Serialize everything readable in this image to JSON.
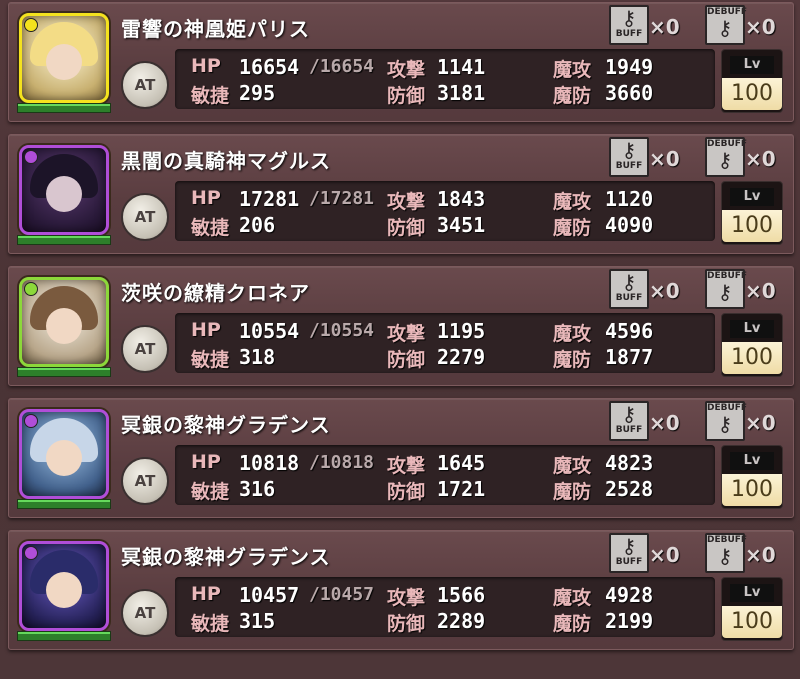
{
  "labels": {
    "hp": "HP",
    "attack": "攻撃",
    "magic_attack": "魔攻",
    "agility": "敏捷",
    "defense": "防御",
    "magic_defense": "魔防",
    "role": "AT",
    "level_tag": "Lv",
    "buff_tag": "BUFF",
    "debuff_tag": "DEBUFF",
    "buff_count": "×0",
    "debuff_count": "×0"
  },
  "units": [
    {
      "name": "雷響の神凰姫パリス",
      "attribute": "light",
      "hp": "16654",
      "hp_max": "/16654",
      "attack": "1141",
      "magic_attack": "1949",
      "agility": "295",
      "defense": "3181",
      "magic_defense": "3660",
      "level": "100",
      "hp_fraction": 1.0
    },
    {
      "name": "黒闇の真騎神マグルス",
      "attribute": "dark",
      "hp": "17281",
      "hp_max": "/17281",
      "attack": "1843",
      "magic_attack": "1120",
      "agility": "206",
      "defense": "3451",
      "magic_defense": "4090",
      "level": "100",
      "hp_fraction": 1.0
    },
    {
      "name": "茨咲の繚精クロネア",
      "attribute": "wood",
      "hp": "10554",
      "hp_max": "/10554",
      "attack": "1195",
      "magic_attack": "4596",
      "agility": "318",
      "defense": "2279",
      "magic_defense": "1877",
      "level": "100",
      "hp_fraction": 1.0
    },
    {
      "name": "冥銀の黎神グラデンス",
      "attribute": "dark",
      "hp": "10818",
      "hp_max": "/10818",
      "attack": "1645",
      "magic_attack": "4823",
      "agility": "316",
      "defense": "1721",
      "magic_defense": "2528",
      "level": "100",
      "hp_fraction": 1.0
    },
    {
      "name": "冥銀の黎神グラデンス",
      "attribute": "dark",
      "hp": "10457",
      "hp_max": "/10457",
      "attack": "1566",
      "magic_attack": "4928",
      "agility": "315",
      "defense": "2289",
      "magic_defense": "2199",
      "level": "100",
      "hp_fraction": 1.0
    }
  ],
  "colors": {
    "light": "#f4e21e",
    "dark": "#b04ed8",
    "wood": "#8cd83a",
    "hp_bar": "#2d7f2a"
  }
}
